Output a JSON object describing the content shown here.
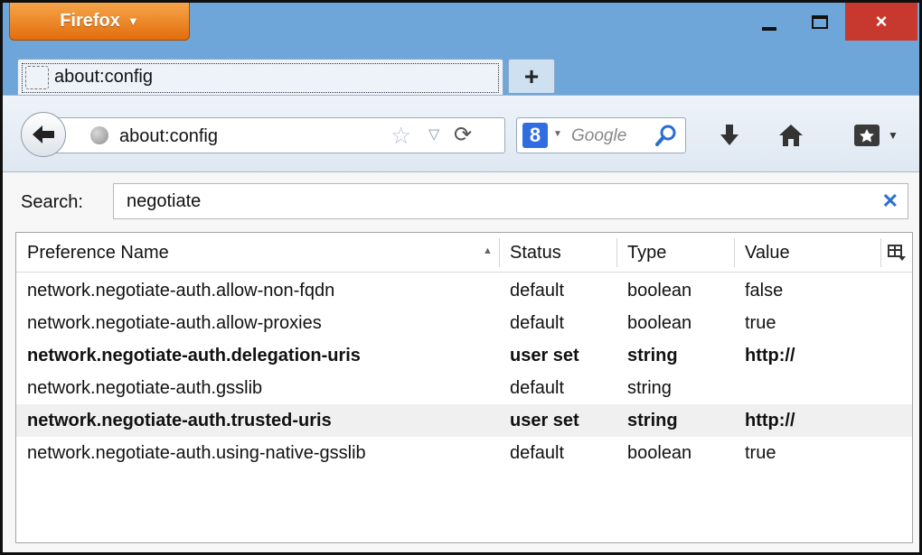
{
  "titlebar": {
    "app_menu_label": "Firefox",
    "app_menu_caret": "▼",
    "close_glyph": "×"
  },
  "tabs": [
    {
      "title": "about:config",
      "selected": true
    }
  ],
  "new_tab_glyph": "+",
  "navbar": {
    "url": "about:config",
    "search_placeholder": "Google",
    "search_engine_glyph": "8",
    "icons": [
      "back-arrow-icon",
      "globe-icon",
      "star-icon",
      "history-dropdown-icon",
      "reload-icon",
      "search-icon",
      "download-icon",
      "home-icon",
      "bookmarks-icon"
    ]
  },
  "config": {
    "search_label": "Search:",
    "search_value": "negotiate",
    "columns": {
      "name": "Preference Name",
      "status": "Status",
      "type": "Type",
      "value": "Value"
    },
    "rows": [
      {
        "name": "network.negotiate-auth.allow-non-fqdn",
        "status": "default",
        "type": "boolean",
        "value": "false",
        "user_set": false
      },
      {
        "name": "network.negotiate-auth.allow-proxies",
        "status": "default",
        "type": "boolean",
        "value": "true",
        "user_set": false
      },
      {
        "name": "network.negotiate-auth.delegation-uris",
        "status": "user set",
        "type": "string",
        "value": "http://",
        "user_set": true
      },
      {
        "name": "network.negotiate-auth.gsslib",
        "status": "default",
        "type": "string",
        "value": "",
        "user_set": false
      },
      {
        "name": "network.negotiate-auth.trusted-uris",
        "status": "user set",
        "type": "string",
        "value": "http://",
        "user_set": true
      },
      {
        "name": "network.negotiate-auth.using-native-gsslib",
        "status": "default",
        "type": "boolean",
        "value": "true",
        "user_set": false
      }
    ]
  },
  "colors": {
    "titlebar_bg": "#6fa6d9",
    "firefox_button": "#e36d0c",
    "close_button": "#c7392e",
    "accent_blue": "#2b6ed1"
  }
}
